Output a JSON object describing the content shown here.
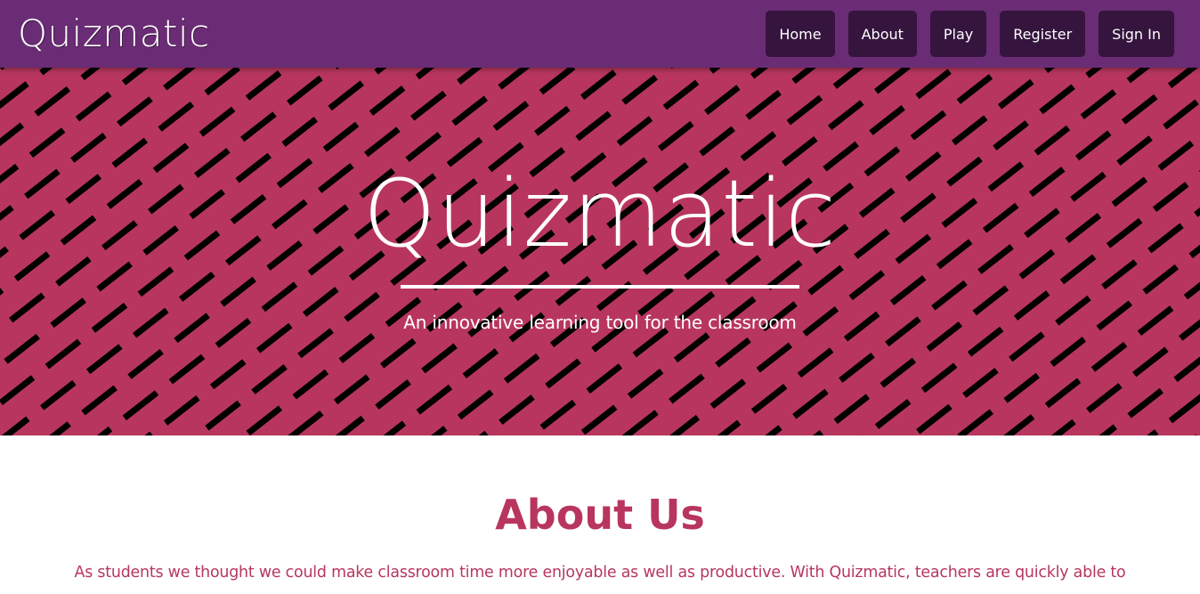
{
  "navbar": {
    "brand": "Quizmatic",
    "items": [
      {
        "label": "Home"
      },
      {
        "label": "About"
      },
      {
        "label": "Play"
      },
      {
        "label": "Register"
      },
      {
        "label": "Sign In"
      }
    ]
  },
  "hero": {
    "title": "Quizmatic",
    "subtitle": "An innovative learning tool for the classroom"
  },
  "about": {
    "title": "About Us",
    "text": "As students we thought we could make classroom time more enjoyable as well as productive. With Quizmatic, teachers are quickly able to"
  },
  "colors": {
    "navbar_bg": "#6a2c74",
    "nav_button_bg": "#35143e",
    "accent": "#b8365e",
    "stripe": "#000000"
  }
}
